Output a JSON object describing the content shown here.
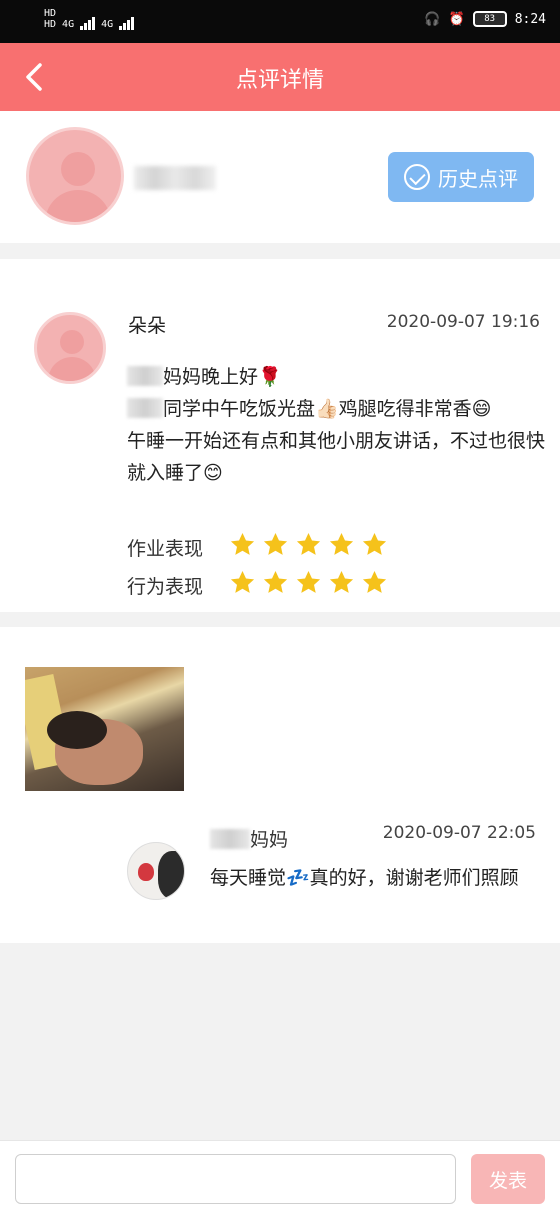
{
  "status_bar": {
    "left_labels": [
      "HD",
      "HD",
      "4G",
      "4G"
    ],
    "time": "8:24",
    "battery_text": "83"
  },
  "nav": {
    "title": "点评详情"
  },
  "profile": {
    "history_button_label": "历史点评"
  },
  "comment": {
    "teacher_name": "朵朵",
    "time": "2020-09-07 19:16",
    "lines": [
      "妈妈晚上好🌹",
      "同学中午吃饭光盘👍🏻鸡腿吃得非常香😄",
      "午睡一开始还有点和其他小朋友讲话，不过也很快就入睡了😊"
    ],
    "ratings": [
      {
        "label": "作业表现",
        "stars": 5
      },
      {
        "label": "行为表现",
        "stars": 5
      }
    ],
    "star_color": "#f5c21b"
  },
  "reply": {
    "name": "妈妈",
    "time": "2020-09-07 22:05",
    "text": "每天睡觉💤真的好，谢谢老师们照顾"
  },
  "composer": {
    "input_value": "",
    "input_placeholder": "",
    "send_label": "发表"
  },
  "colors": {
    "accent": "#f87070",
    "history_button": "#7fb8f2",
    "send_button": "#f8b6b6"
  }
}
